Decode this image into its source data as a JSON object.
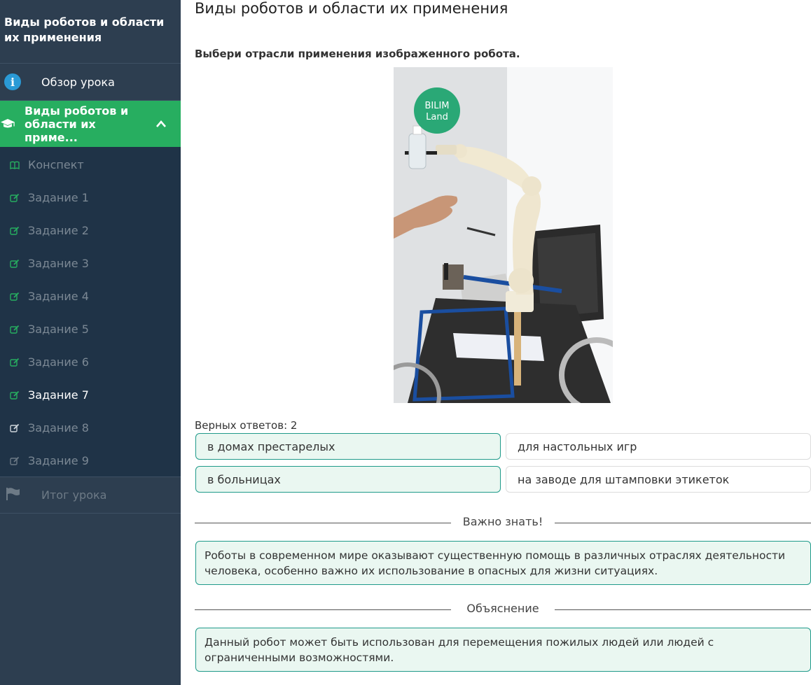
{
  "sidebar": {
    "title": "Виды роботов и области их применения",
    "overview_label": "Обзор урока",
    "active_section_label": "Виды роботов и области их приме...",
    "items": [
      {
        "label": "Конспект",
        "icon": "book-icon",
        "state": "visited"
      },
      {
        "label": "Задание 1",
        "icon": "edit-icon",
        "state": "done"
      },
      {
        "label": "Задание 2",
        "icon": "edit-icon",
        "state": "done"
      },
      {
        "label": "Задание 3",
        "icon": "edit-icon",
        "state": "done"
      },
      {
        "label": "Задание 4",
        "icon": "edit-icon",
        "state": "done"
      },
      {
        "label": "Задание 5",
        "icon": "edit-icon",
        "state": "done"
      },
      {
        "label": "Задание 6",
        "icon": "edit-icon",
        "state": "done"
      },
      {
        "label": "Задание 7",
        "icon": "edit-icon",
        "state": "current"
      },
      {
        "label": "Задание 8",
        "icon": "edit-icon",
        "state": "todo"
      },
      {
        "label": "Задание 9",
        "icon": "edit-icon",
        "state": "todo"
      }
    ],
    "final_label": "Итог урока"
  },
  "main": {
    "page_title": "Виды роботов и области их применения",
    "question": "Выбери отрасли применения изображенного робота.",
    "image_logo_line1": "BILIM",
    "image_logo_line2": "Land",
    "correct_count": "Верных ответов: 2",
    "options": [
      {
        "label": "в домах престарелых",
        "selected": true
      },
      {
        "label": "для настольных игр",
        "selected": false
      },
      {
        "label": "в больницах",
        "selected": true
      },
      {
        "label": "на заводе для штамповки этикеток",
        "selected": false
      }
    ],
    "important_heading": "Важно знать!",
    "important_text": "Роботы в современном мире оказывают существенную помощь в различных отраслях деятельности человека, особенно важно их использование в опасных для жизни ситуациях.",
    "explanation_heading": "Объяснение",
    "explanation_text": "Данный робот может быть использован для перемещения пожилых людей или людей с ограниченными возможностями."
  },
  "colors": {
    "sidebar_bg": "#2d3e50",
    "sidebar_sub_bg": "#1f3347",
    "active_green": "#27ae60",
    "info_blue": "#2a9ad6",
    "accent_teal": "#1f9a8a",
    "selected_bg": "#eaf7f1"
  }
}
